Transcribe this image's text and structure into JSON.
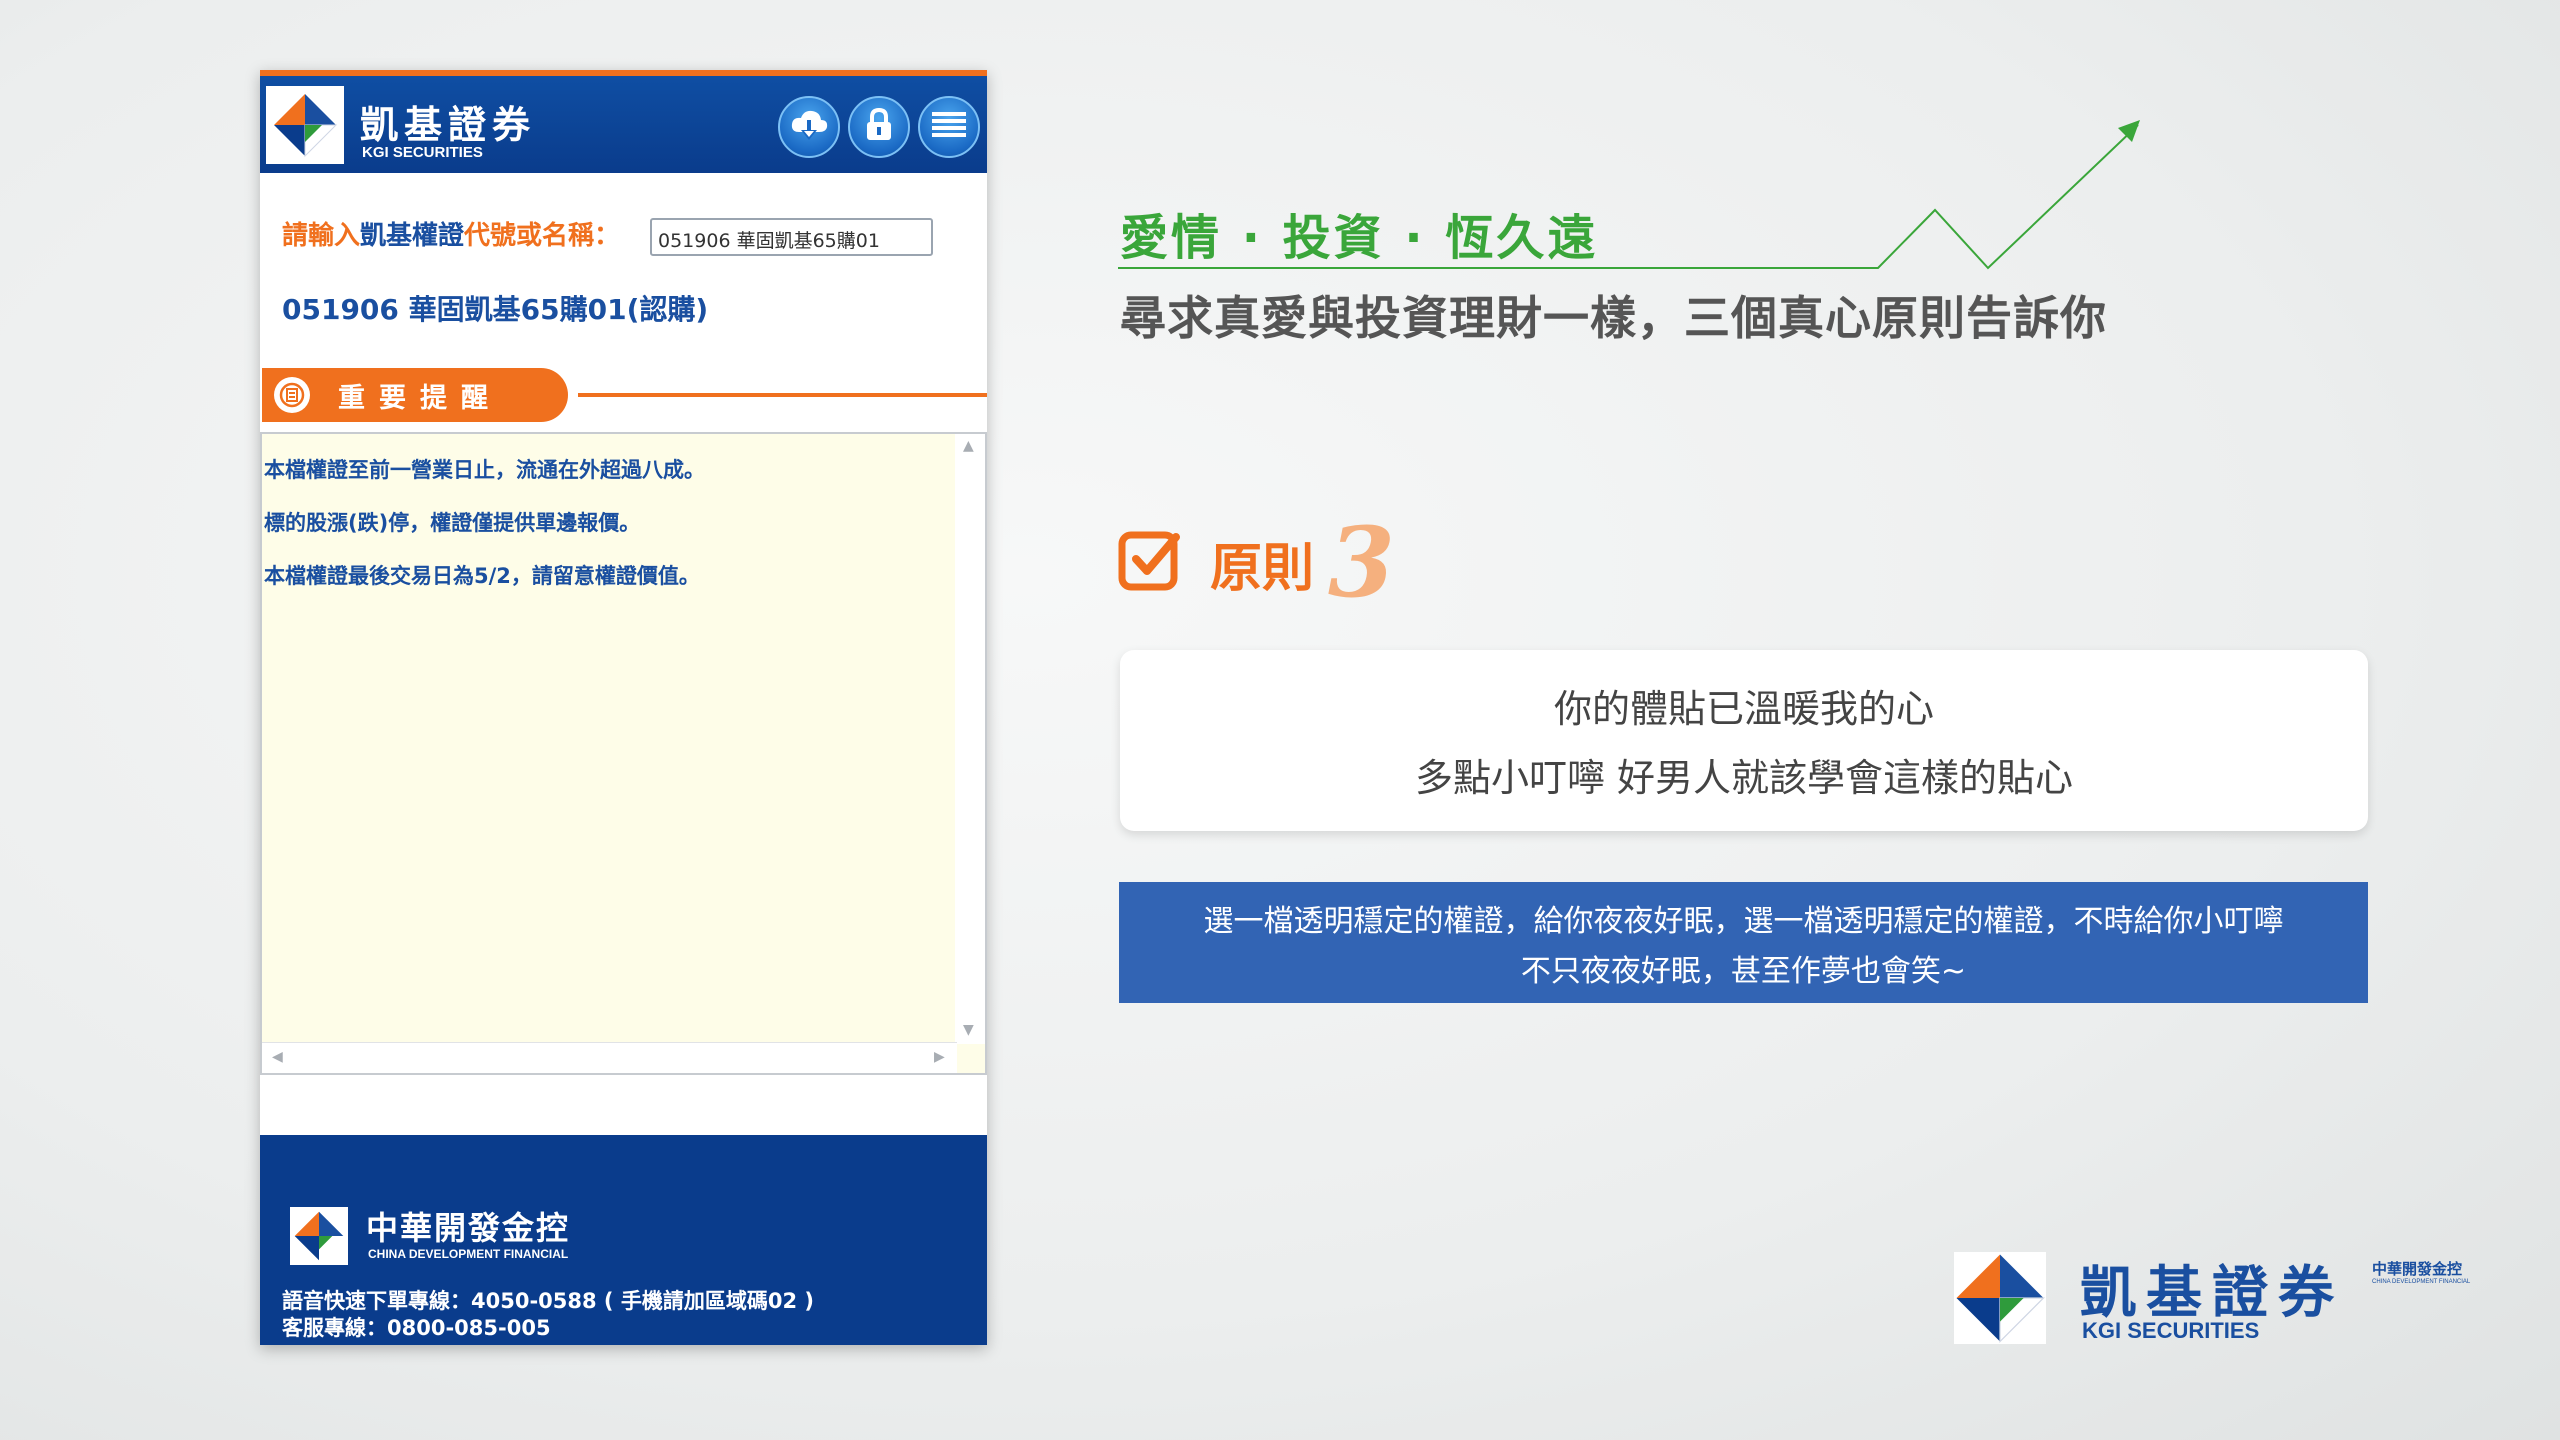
{
  "phone": {
    "brand_title": "凱基證券",
    "brand_sub": "KGI SECURITIES",
    "header_buttons": [
      {
        "icon": "cloud-download-icon"
      },
      {
        "icon": "lock-icon"
      },
      {
        "icon": "menu-icon"
      }
    ],
    "query": {
      "prefix": "請輸入",
      "brand": "凱基權證",
      "suffix": "代號或名稱：",
      "input_value": "051906 華固凱基65購01"
    },
    "result_name": "051906 華固凱基65購01(認購)",
    "notice_title": "重要提醒",
    "notices": [
      "本檔權證至前一營業日止，流通在外超過八成。",
      "標的股漲(跌)停，權證僅提供單邊報價。",
      "本檔權證最後交易日為5/2，請留意權證價值。"
    ],
    "footer": {
      "cdf_title": "中華開發金控",
      "cdf_sub": "CHINA DEVELOPMENT FINANCIAL",
      "hotline1": "語音快速下單專線：4050-0588 ( 手機請加區域碼02 )",
      "hotline2": "客服專線：0800-085-005"
    }
  },
  "headline": {
    "green": "愛情 · 投資 · 恆久遠",
    "grey": "尋求真愛與投資理財一樣，三個真心原則告訴你"
  },
  "principle": {
    "label": "原則",
    "number": "3"
  },
  "quote": {
    "line1": "你的體貼已溫暖我的心",
    "line2": "多點小叮嚀  好男人就該學會這樣的貼心"
  },
  "banner": {
    "line1": "選一檔透明穩定的權證，給你夜夜好眠，選一檔透明穩定的權證，不時給你小叮嚀",
    "line2": "不只夜夜好眠，甚至作夢也會笑~"
  },
  "corner": {
    "title": "凱基證券",
    "sub": "KGI SECURITIES",
    "cdf": "中華開發金控",
    "cdf_sub": "CHINA DEVELOPMENT FINANCIAL"
  },
  "colors": {
    "brand_blue": "#0a3c8c",
    "accent_orange": "#f0701e",
    "green": "#3aa63a",
    "banner_blue": "#3264b4",
    "notice_bg": "#fefde8"
  }
}
